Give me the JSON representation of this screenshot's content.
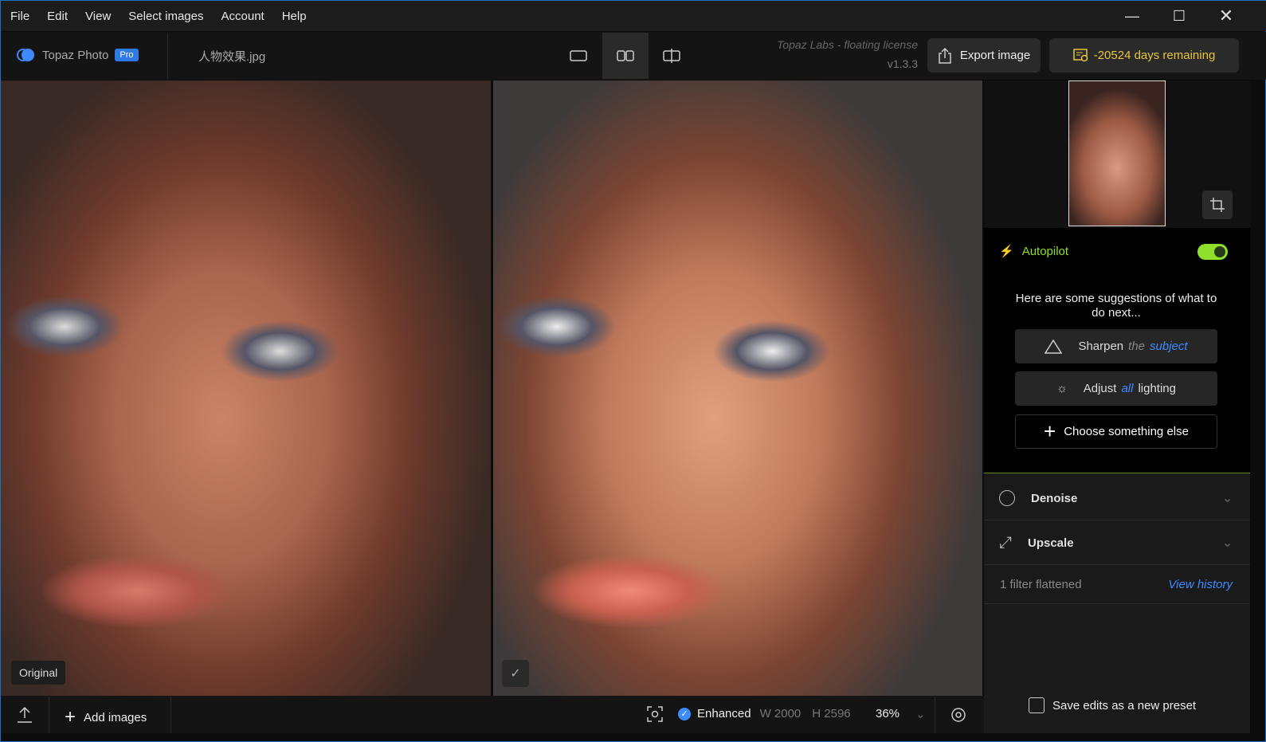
{
  "menu": [
    "File",
    "Edit",
    "View",
    "Select images",
    "Account",
    "Help"
  ],
  "app": {
    "name": "Topaz Photo",
    "badge": "Pro",
    "filename": "人物效果.jpg",
    "license": "Topaz Labs - floating license",
    "version": "v1.3.3",
    "export_label": "Export image",
    "days_remaining": "-20524 days remaining"
  },
  "labels": {
    "original": "Original"
  },
  "autopilot": {
    "title": "Autopilot",
    "enabled": true,
    "prompt": "Here are some suggestions of what to do next...",
    "sharpen": {
      "a": "Sharpen",
      "b": "the",
      "c": "subject"
    },
    "lighting": {
      "a": "Adjust",
      "b": "all",
      "c": "lighting"
    },
    "other": "Choose something else"
  },
  "filters": [
    {
      "label": "Denoise"
    },
    {
      "label": "Upscale"
    }
  ],
  "history": {
    "status": "1 filter flattened",
    "link": "View history"
  },
  "preset": "Save edits as a new preset",
  "bottom": {
    "add_images": "Add images",
    "mode": "Enhanced",
    "width": "W 2000",
    "height": "H 2596",
    "zoom": "36%"
  },
  "colors": {
    "accent": "#3d8bff",
    "autopilot": "#8ee02a",
    "license": "#e8c53a"
  }
}
